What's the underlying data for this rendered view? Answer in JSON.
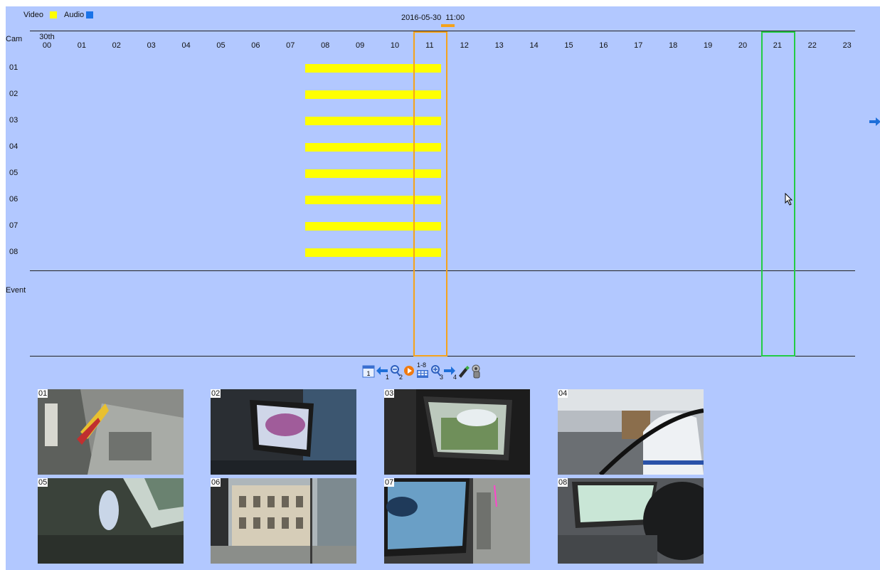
{
  "legend": {
    "video_label": "Video",
    "audio_label": "Audio",
    "video_color": "#ffff00",
    "audio_color": "#1a73e8"
  },
  "header": {
    "date": "2016-05-30",
    "time": "11:00"
  },
  "timeline": {
    "cam_header": "Cam",
    "day_label": "30th",
    "hours": [
      "00",
      "01",
      "02",
      "03",
      "04",
      "05",
      "06",
      "07",
      "08",
      "09",
      "10",
      "11",
      "12",
      "13",
      "14",
      "15",
      "16",
      "17",
      "18",
      "19",
      "20",
      "21",
      "22",
      "23"
    ],
    "cameras": [
      "01",
      "02",
      "03",
      "04",
      "05",
      "06",
      "07",
      "08"
    ],
    "event_label": "Event",
    "recording": {
      "start_hour": 7.6,
      "end_hour": 11.5
    },
    "selected_hour": "11",
    "hover_hour": "21",
    "selected_color": "#f5a21a",
    "hover_color": "#22cc44"
  },
  "toolbar": {
    "items": [
      {
        "name": "calendar-icon",
        "sub": "1"
      },
      {
        "name": "prev-arrow-icon",
        "sub": ""
      },
      {
        "name": "zoom-out-icon",
        "sub": "2"
      },
      {
        "name": "play-icon",
        "sub": ""
      },
      {
        "name": "grid-icon",
        "sub": "1-8"
      },
      {
        "name": "zoom-in-icon",
        "sub": "3"
      },
      {
        "name": "next-arrow-icon",
        "sub": "4"
      },
      {
        "name": "usb-backup-icon",
        "sub": ""
      },
      {
        "name": "tools-icon",
        "sub": ""
      }
    ]
  },
  "thumbnails": [
    {
      "num": "01"
    },
    {
      "num": "02"
    },
    {
      "num": "03"
    },
    {
      "num": "04"
    },
    {
      "num": "05"
    },
    {
      "num": "06"
    },
    {
      "num": "07"
    },
    {
      "num": "08"
    }
  ]
}
